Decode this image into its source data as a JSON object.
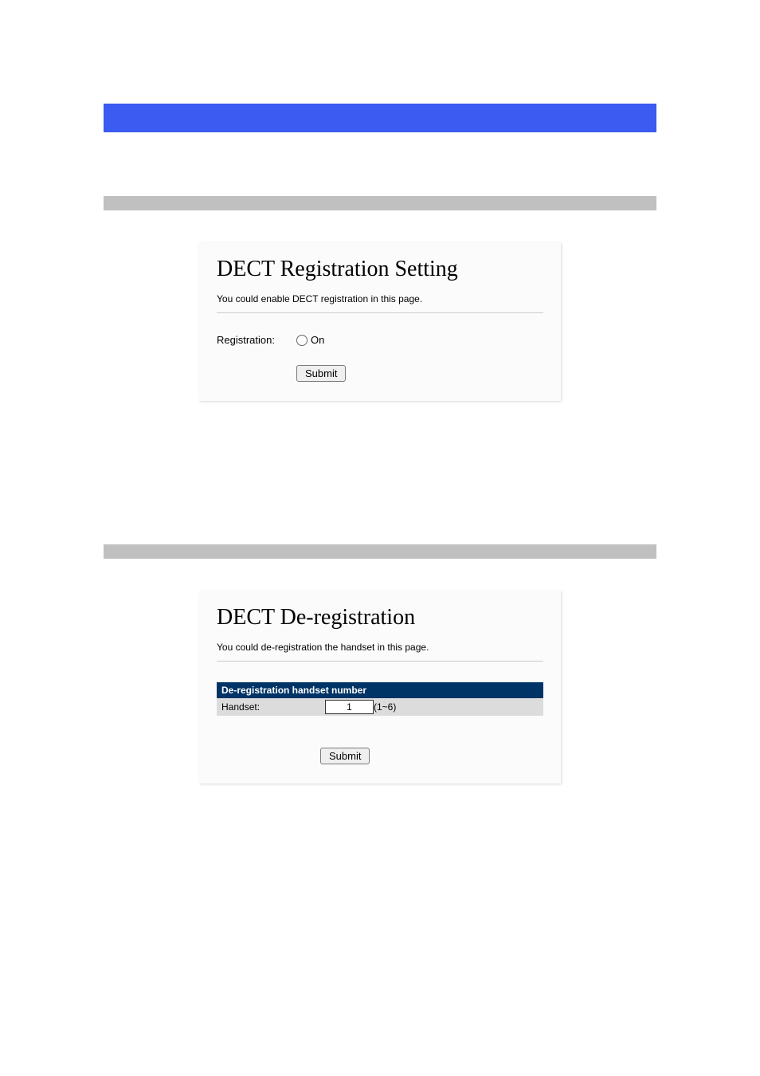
{
  "section1": {
    "title": "DECT Registration Setting",
    "description": "You could enable DECT registration in this page.",
    "registration_label": "Registration:",
    "radio_on_label": "On",
    "submit_label": "Submit"
  },
  "section2": {
    "title": "DECT De-registration",
    "description": "You could de-registration the handset in this page.",
    "table_header": "De-registration handset number",
    "handset_label": "Handset:",
    "handset_value": "1",
    "handset_range": "(1~6)",
    "submit_label": "Submit"
  }
}
